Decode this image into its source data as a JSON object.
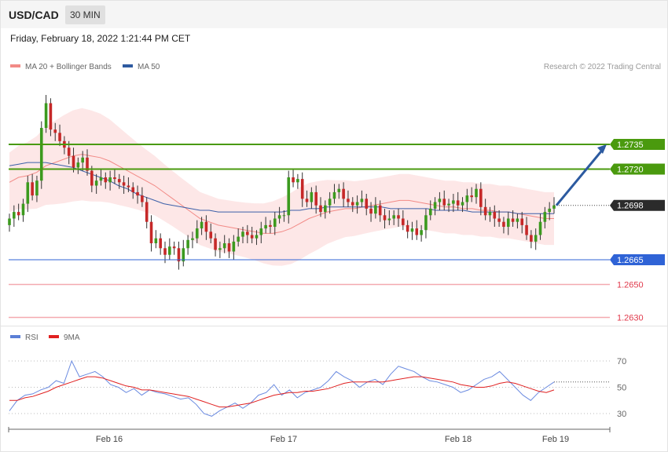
{
  "header": {
    "pair": "USD/CAD",
    "timeframe": "30 MIN",
    "datetime": "Friday, February 18, 2022 1:21:44 PM CET",
    "credit": "Research © 2022 Trading Central"
  },
  "legend": {
    "ma20": {
      "label": "MA 20 + Bollinger Bands",
      "color": "#f28a86"
    },
    "ma50": {
      "label": "MA 50",
      "color": "#2e5aa0"
    },
    "rsi": {
      "label": "RSI",
      "color": "#5b7fd6"
    },
    "ma9": {
      "label": "9MA",
      "color": "#e02020"
    }
  },
  "chart_data": [
    {
      "type": "line",
      "title": "",
      "ylim": [
        1.2615,
        1.2755
      ],
      "x_labels": [
        "Feb 16",
        "Feb 17",
        "Feb 18",
        "Feb 19"
      ],
      "levels": [
        {
          "value": "1.2735",
          "kind": "resistance",
          "color": "#4a9a0e"
        },
        {
          "value": "1.2720",
          "kind": "resistance",
          "color": "#4a9a0e"
        },
        {
          "value": "1.2698",
          "kind": "current",
          "color": "#333333"
        },
        {
          "value": "1.2665",
          "kind": "support",
          "color": "#2f63d6"
        },
        {
          "value": "1.2650",
          "kind": "support",
          "color": "#e0394b"
        },
        {
          "value": "1.2630",
          "kind": "support",
          "color": "#e0394b"
        }
      ],
      "projection": {
        "from": 1.2698,
        "to": 1.2735
      },
      "close": [
        1.269,
        1.2694,
        1.2692,
        1.2699,
        1.2712,
        1.2704,
        1.2713,
        1.2745,
        1.276,
        1.2744,
        1.2742,
        1.2737,
        1.2733,
        1.2728,
        1.2721,
        1.2724,
        1.2727,
        1.2719,
        1.271,
        1.2713,
        1.2715,
        1.2712,
        1.2715,
        1.2714,
        1.2712,
        1.271,
        1.2709,
        1.2706,
        1.2704,
        1.27,
        1.2688,
        1.2675,
        1.2678,
        1.2672,
        1.2668,
        1.2673,
        1.2672,
        1.2664,
        1.2672,
        1.2677,
        1.2678,
        1.2684,
        1.2688,
        1.2682,
        1.2678,
        1.2671,
        1.2672,
        1.2675,
        1.267,
        1.2676,
        1.2679,
        1.2682,
        1.268,
        1.2678,
        1.268,
        1.2684,
        1.2686,
        1.2685,
        1.269,
        1.2692,
        1.2692,
        1.2715,
        1.2712,
        1.2714,
        1.2702,
        1.27,
        1.2706,
        1.2698,
        1.2694,
        1.2698,
        1.2702,
        1.2706,
        1.2708,
        1.2702,
        1.27,
        1.2698,
        1.27,
        1.2702,
        1.2696,
        1.2693,
        1.2698,
        1.2692,
        1.2689,
        1.269,
        1.2692,
        1.269,
        1.2686,
        1.2682,
        1.2684,
        1.268,
        1.2683,
        1.2692,
        1.2696,
        1.27,
        1.2702,
        1.2698,
        1.2699,
        1.2701,
        1.2698,
        1.27,
        1.2704,
        1.2703,
        1.2708,
        1.2697,
        1.2692,
        1.2694,
        1.269,
        1.2688,
        1.2685,
        1.269,
        1.2688,
        1.269,
        1.2686,
        1.268,
        1.2676,
        1.268,
        1.2688,
        1.2694,
        1.2696,
        1.2698
      ],
      "ma20": [
        1.2712,
        1.2715,
        1.2716,
        1.2718,
        1.2722,
        1.2724,
        1.2726,
        1.2728,
        1.2729,
        1.2728,
        1.2727,
        1.2725,
        1.2722,
        1.2719,
        1.2716,
        1.2713,
        1.271,
        1.2706,
        1.2702,
        1.2698,
        1.2694,
        1.269,
        1.2688,
        1.2686,
        1.2685,
        1.2684,
        1.2683,
        1.2682,
        1.2681,
        1.2681,
        1.2682,
        1.2684,
        1.2687,
        1.269,
        1.2692,
        1.2694,
        1.2695,
        1.2696,
        1.2696,
        1.2697,
        1.2698,
        1.2699,
        1.27,
        1.2701,
        1.2701,
        1.27,
        1.2699,
        1.2698,
        1.2697,
        1.2697,
        1.2696,
        1.2696,
        1.2695,
        1.2695,
        1.2694,
        1.2694,
        1.2693,
        1.2692,
        1.2691,
        1.269,
        1.269
      ],
      "ma50": [
        1.2722,
        1.2723,
        1.2724,
        1.2724,
        1.2724,
        1.2723,
        1.2722,
        1.2721,
        1.2719,
        1.2717,
        1.2715,
        1.2713,
        1.271,
        1.2708,
        1.2705,
        1.2703,
        1.2701,
        1.2699,
        1.2698,
        1.2697,
        1.2696,
        1.2695,
        1.2695,
        1.2694,
        1.2694,
        1.2694,
        1.2694,
        1.2694,
        1.2694,
        1.2694,
        1.2694,
        1.2695,
        1.2695,
        1.2696,
        1.2696,
        1.2697,
        1.2697,
        1.2697,
        1.2697,
        1.2697,
        1.2697,
        1.2697,
        1.2696,
        1.2696,
        1.2696,
        1.2696,
        1.2696,
        1.2695,
        1.2695,
        1.2695,
        1.2695,
        1.2694,
        1.2694,
        1.2694,
        1.2694,
        1.2694,
        1.2693,
        1.2693,
        1.2693,
        1.2693,
        1.2693
      ]
    },
    {
      "type": "line",
      "title": "",
      "ylim": [
        20,
        80
      ],
      "y_ticks": [
        "70",
        "50",
        "30"
      ],
      "series": [
        {
          "name": "RSI",
          "values": [
            32,
            40,
            44,
            45,
            48,
            50,
            55,
            53,
            70,
            58,
            60,
            62,
            58,
            52,
            50,
            46,
            49,
            44,
            48,
            46,
            45,
            43,
            41,
            42,
            37,
            30,
            28,
            32,
            35,
            38,
            34,
            38,
            44,
            46,
            52,
            44,
            48,
            42,
            46,
            48,
            50,
            55,
            62,
            58,
            55,
            50,
            54,
            56,
            52,
            60,
            66,
            64,
            62,
            58,
            55,
            54,
            52,
            50,
            46,
            48,
            52,
            56,
            58,
            62,
            56,
            50,
            44,
            40,
            46,
            50,
            54
          ]
        },
        {
          "name": "9MA",
          "values": [
            40,
            40,
            42,
            43,
            45,
            47,
            50,
            52,
            54,
            56,
            58,
            58,
            57,
            55,
            53,
            51,
            50,
            48,
            48,
            47,
            46,
            45,
            44,
            43,
            41,
            39,
            37,
            35,
            35,
            36,
            37,
            38,
            40,
            42,
            44,
            45,
            46,
            46,
            47,
            47,
            48,
            49,
            51,
            53,
            54,
            54,
            54,
            54,
            54,
            55,
            56,
            57,
            58,
            58,
            57,
            56,
            55,
            54,
            52,
            51,
            50,
            50,
            51,
            53,
            54,
            53,
            51,
            49,
            47,
            46,
            48
          ]
        }
      ]
    }
  ]
}
